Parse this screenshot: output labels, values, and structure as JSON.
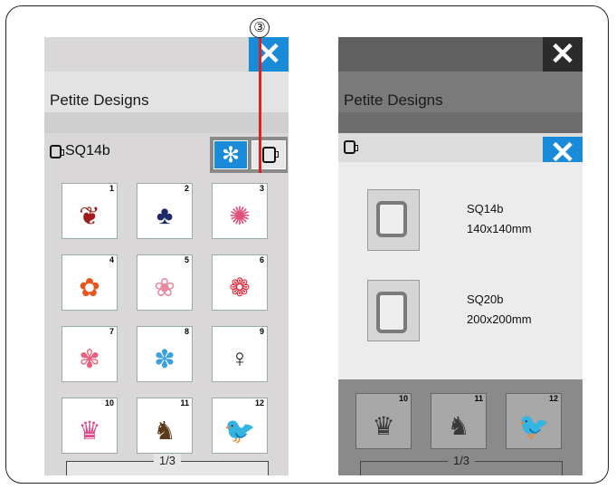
{
  "callout": "③",
  "left_panel": {
    "close_icon": "✕",
    "title": "Petite Designs",
    "hoop_label": "SQ14b",
    "flower_icon": "✻",
    "pager": "1/3",
    "designs": [
      {
        "num": "1",
        "icon": "❦",
        "color": "#a01c1c"
      },
      {
        "num": "2",
        "icon": "♣",
        "color": "#1c2a6a"
      },
      {
        "num": "3",
        "icon": "✺",
        "color": "#e0507a"
      },
      {
        "num": "4",
        "icon": "✿",
        "color": "#e8541c"
      },
      {
        "num": "5",
        "icon": "❀",
        "color": "#e88aa0"
      },
      {
        "num": "6",
        "icon": "❁",
        "color": "#e02a3a"
      },
      {
        "num": "7",
        "icon": "✾",
        "color": "#e8607a"
      },
      {
        "num": "8",
        "icon": "✽",
        "color": "#3aa0e0"
      },
      {
        "num": "9",
        "icon": "♀",
        "color": "#222222"
      },
      {
        "num": "10",
        "icon": "♛",
        "color": "#e04a8a"
      },
      {
        "num": "11",
        "icon": "♞",
        "color": "#5a3a1a"
      },
      {
        "num": "12",
        "icon": "🐦",
        "color": "#3aa0c8"
      }
    ]
  },
  "right_panel": {
    "close_icon": "✕",
    "title": "Petite Designs",
    "sub_close_icon": "✕",
    "hoops": [
      {
        "name": "SQ14b",
        "size": "140x140mm"
      },
      {
        "name": "SQ20b",
        "size": "200x200mm"
      }
    ],
    "pager": "1/3",
    "designs": [
      {
        "num": "10",
        "icon": "♛"
      },
      {
        "num": "11",
        "icon": "♞"
      },
      {
        "num": "12",
        "icon": "🐦"
      }
    ]
  }
}
